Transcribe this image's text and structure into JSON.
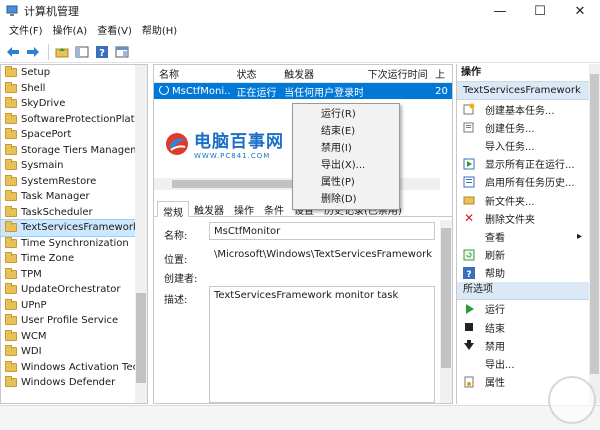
{
  "window": {
    "title": "计算机管理",
    "minimize": "—",
    "maximize": "☐",
    "close": "✕"
  },
  "menu": [
    "文件(F)",
    "操作(A)",
    "查看(V)",
    "帮助(H)"
  ],
  "toolbar": {
    "icons": [
      "back-arrow-icon",
      "forward-arrow-icon",
      "up-folder-icon",
      "show-hide-tree-icon",
      "help-icon",
      "console-icon"
    ]
  },
  "tree": {
    "items": [
      "Setup",
      "Shell",
      "SkyDrive",
      "SoftwareProtectionPlatform",
      "SpacePort",
      "Storage Tiers Management",
      "Sysmain",
      "SystemRestore",
      "Task Manager",
      "TaskScheduler",
      "TextServicesFramework",
      "Time Synchronization",
      "Time Zone",
      "TPM",
      "UpdateOrchestrator",
      "UPnP",
      "User Profile Service",
      "WCM",
      "WDI",
      "Windows Activation Technologies",
      "Windows Defender"
    ],
    "selected_index": 10
  },
  "tasklist": {
    "headers": [
      "名称",
      "状态",
      "触发器",
      "下次运行时间",
      "上"
    ],
    "rows": [
      {
        "name": "MsCtfMoni...",
        "status": "正在运行",
        "trigger": "当任何用户登录时",
        "next_run": "",
        "last": "20"
      }
    ]
  },
  "watermark": {
    "brand": "电脑百事网",
    "url": "WWW.PC841.COM"
  },
  "details": {
    "tabs": [
      "常规",
      "触发器",
      "操作",
      "条件",
      "设置",
      "历史记录(已禁用)"
    ],
    "active_tab": 0,
    "name_label": "名称:",
    "name_value": "MsCtfMonitor",
    "location_label": "位置:",
    "location_value": "\\Microsoft\\Windows\\TextServicesFramework",
    "author_label": "创建者:",
    "author_value": "",
    "desc_label": "描述:",
    "desc_value": "TextServicesFramework monitor task"
  },
  "context_menu": [
    "运行(R)",
    "结束(E)",
    "禁用(I)",
    "导出(X)...",
    "属性(P)",
    "删除(D)"
  ],
  "actions": {
    "header": "操作",
    "section1": {
      "title": "TextServicesFramework",
      "items": [
        {
          "label": "创建基本任务...",
          "icon": "create-basic-task-icon"
        },
        {
          "label": "创建任务...",
          "icon": "create-task-icon"
        },
        {
          "label": "导入任务...",
          "icon": "import-task-icon"
        },
        {
          "label": "显示所有正在运行...",
          "icon": "running-tasks-icon"
        },
        {
          "label": "启用所有任务历史...",
          "icon": "history-icon"
        },
        {
          "label": "新文件夹...",
          "icon": "new-folder-icon"
        },
        {
          "label": "删除文件夹",
          "icon": "delete-x-icon"
        },
        {
          "label": "查看",
          "icon": "view-icon"
        },
        {
          "label": "刷新",
          "icon": "refresh-icon"
        },
        {
          "label": "帮助",
          "icon": "help-icon"
        }
      ]
    },
    "section2": {
      "title": "所选项",
      "items": [
        {
          "label": "运行",
          "icon": "run-icon"
        },
        {
          "label": "结束",
          "icon": "stop-icon"
        },
        {
          "label": "禁用",
          "icon": "disable-icon"
        },
        {
          "label": "导出...",
          "icon": "export-icon"
        },
        {
          "label": "属性",
          "icon": "properties-icon"
        }
      ]
    }
  },
  "colors": {
    "selection": "#0078d7",
    "tree_selection": "#cce8ff",
    "section_header": "#dbe9f6",
    "watermark_blue": "#1b6fc4"
  }
}
